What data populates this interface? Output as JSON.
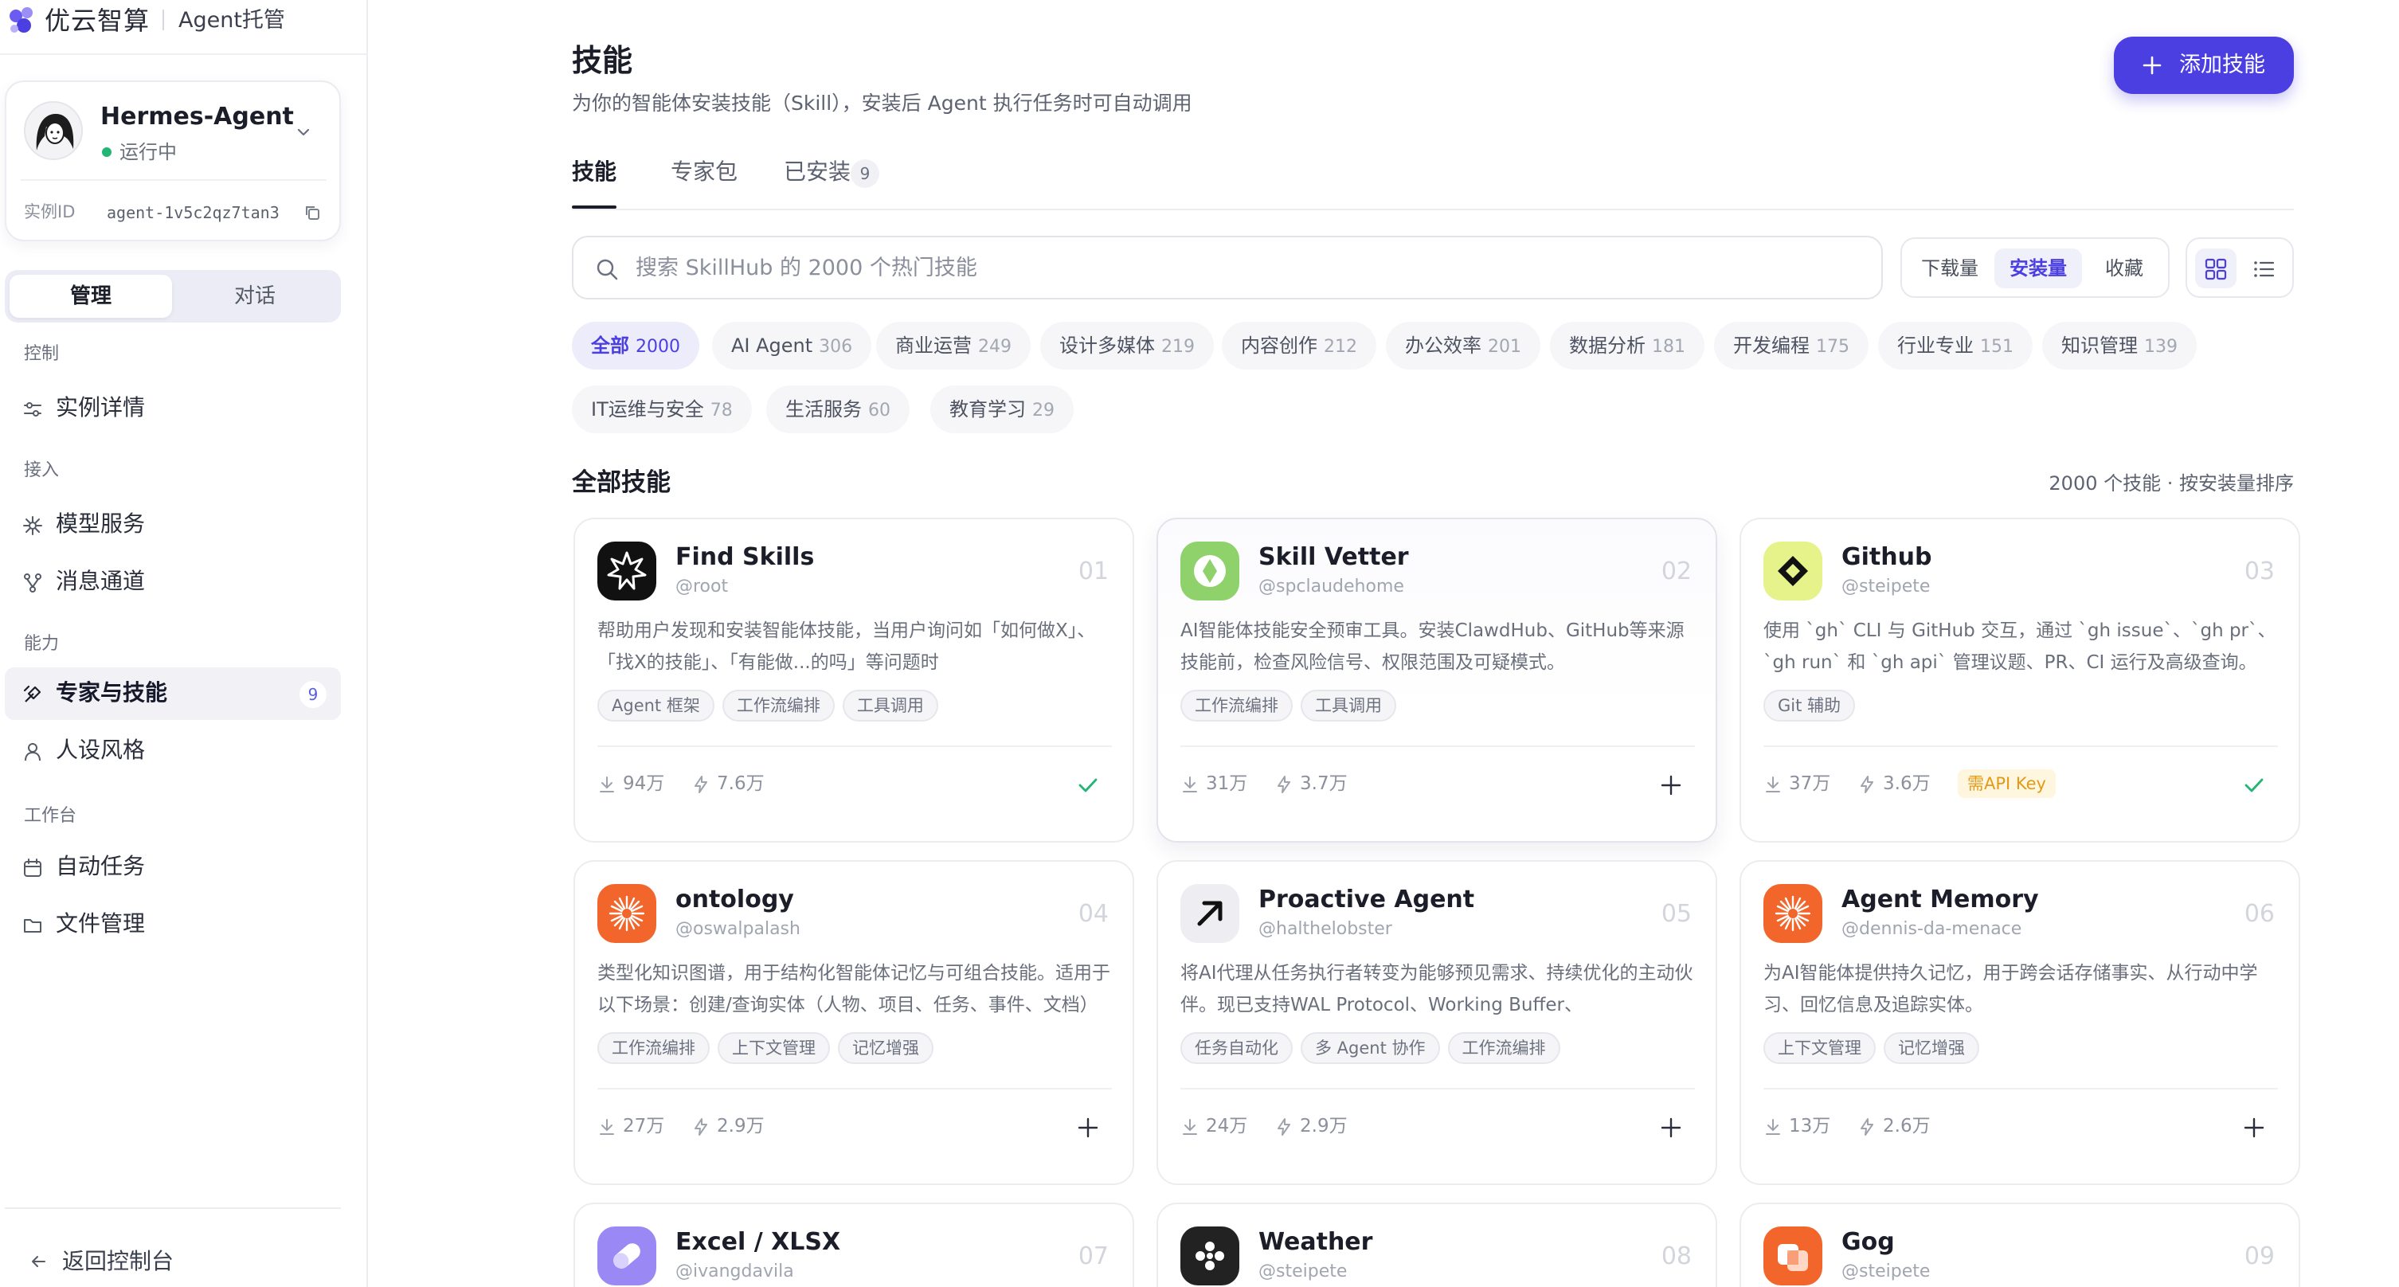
{
  "brand": {
    "name": "优云智算",
    "product": "Agent托管"
  },
  "agent": {
    "name": "Hermes-Agent",
    "status": "运行中",
    "instance_label": "实例ID",
    "instance_id": "agent-1v5c2qz7tan3"
  },
  "mode_tabs": {
    "manage": "管理",
    "chat": "对话"
  },
  "nav": {
    "sections": [
      {
        "label": "控制",
        "items": [
          {
            "label": "实例详情",
            "icon": "sliders-icon"
          }
        ]
      },
      {
        "label": "接入",
        "items": [
          {
            "label": "模型服务",
            "icon": "spark-icon"
          },
          {
            "label": "消息通道",
            "icon": "branch-icon"
          }
        ]
      },
      {
        "label": "能力",
        "items": [
          {
            "label": "专家与技能",
            "icon": "tool-icon",
            "badge": "9",
            "active": true
          },
          {
            "label": "人设风格",
            "icon": "user-icon"
          }
        ]
      },
      {
        "label": "工作台",
        "items": [
          {
            "label": "自动任务",
            "icon": "calendar-icon"
          },
          {
            "label": "文件管理",
            "icon": "folder-icon"
          }
        ]
      }
    ],
    "back": "返回控制台"
  },
  "page": {
    "title": "技能",
    "subtitle": "为你的智能体安装技能（Skill），安装后 Agent 执行任务时可自动调用",
    "add_button": "添加技能",
    "tabs": [
      {
        "label": "技能",
        "active": true
      },
      {
        "label": "专家包"
      },
      {
        "label": "已安装",
        "badge": "9"
      }
    ],
    "search_placeholder": "搜索 SkillHub 的 2000 个热门技能",
    "sort": [
      {
        "label": "下载量"
      },
      {
        "label": "安装量",
        "active": true
      },
      {
        "label": "收藏"
      }
    ],
    "view_mode": "grid"
  },
  "categories": [
    {
      "label": "全部",
      "count": "2000",
      "active": true
    },
    {
      "label": "AI Agent",
      "count": "306"
    },
    {
      "label": "商业运营",
      "count": "249"
    },
    {
      "label": "设计多媒体",
      "count": "219"
    },
    {
      "label": "内容创作",
      "count": "212"
    },
    {
      "label": "办公效率",
      "count": "201"
    },
    {
      "label": "数据分析",
      "count": "181"
    },
    {
      "label": "开发编程",
      "count": "175"
    },
    {
      "label": "行业专业",
      "count": "151"
    },
    {
      "label": "知识管理",
      "count": "139"
    },
    {
      "label": "IT运维与安全",
      "count": "78"
    },
    {
      "label": "生活服务",
      "count": "60"
    },
    {
      "label": "教育学习",
      "count": "29"
    }
  ],
  "list": {
    "title": "全部技能",
    "meta": "2000 个技能 · 按安装量排序"
  },
  "skills": [
    {
      "num": "01",
      "name": "Find Skills",
      "author": "@root",
      "desc": "帮助用户发现和安装智能体技能，当用户询问如「如何做X」、「找X的技能」、「有能做...的吗」等问题时",
      "tags": [
        "Agent 框架",
        "工作流编排",
        "工具调用"
      ],
      "downloads": "94万",
      "installs": "7.6万",
      "installed": true,
      "icon_color": "#111111"
    },
    {
      "num": "02",
      "name": "Skill Vetter",
      "author": "@spclaudehome",
      "desc": "AI智能体技能安全预审工具。安装ClawdHub、GitHub等来源技能前，检查风险信号、权限范围及可疑模式。",
      "tags": [
        "工作流编排",
        "工具调用"
      ],
      "downloads": "31万",
      "installs": "3.7万",
      "installed": false,
      "icon_color": "#8fd16a"
    },
    {
      "num": "03",
      "name": "Github",
      "author": "@steipete",
      "desc": "使用 `gh` CLI 与 GitHub 交互，通过 `gh issue`、`gh pr`、`gh run` 和 `gh api` 管理议题、PR、CI 运行及高级查询。",
      "tags": [
        "Git 辅助"
      ],
      "downloads": "37万",
      "installs": "3.6万",
      "installed": true,
      "api_key": "需API Key",
      "icon_color": "#e6f28a"
    },
    {
      "num": "04",
      "name": "ontology",
      "author": "@oswalpalash",
      "desc": "类型化知识图谱，用于结构化智能体记忆与可组合技能。适用于以下场景：创建/查询实体（人物、项目、任务、事件、文档）",
      "tags": [
        "工作流编排",
        "上下文管理",
        "记忆增强"
      ],
      "downloads": "27万",
      "installs": "2.9万",
      "installed": false,
      "icon_color": "#f2662b"
    },
    {
      "num": "05",
      "name": "Proactive Agent",
      "author": "@halthelobster",
      "desc": "将AI代理从任务执行者转变为能够预见需求、持续优化的主动伙伴。现已支持WAL Protocol、Working Buffer、Autonomous Crons",
      "tags": [
        "任务自动化",
        "多 Agent 协作",
        "工作流编排"
      ],
      "downloads": "24万",
      "installs": "2.9万",
      "installed": false,
      "icon_color": "#eeeef2"
    },
    {
      "num": "06",
      "name": "Agent Memory",
      "author": "@dennis-da-menace",
      "desc": "为AI智能体提供持久记忆，用于跨会话存储事实、从行动中学习、回忆信息及追踪实体。",
      "tags": [
        "上下文管理",
        "记忆增强"
      ],
      "downloads": "13万",
      "installs": "2.6万",
      "installed": false,
      "icon_color": "#f2662b"
    },
    {
      "num": "07",
      "name": "Excel / XLSX",
      "author": "@ivangdavila",
      "desc": "",
      "tags": [],
      "downloads": "",
      "installs": "",
      "installed": false,
      "icon_color": "#9a88f5"
    },
    {
      "num": "08",
      "name": "Weather",
      "author": "@steipete",
      "desc": "",
      "tags": [],
      "downloads": "",
      "installs": "",
      "installed": false,
      "icon_color": "#222222"
    },
    {
      "num": "09",
      "name": "Gog",
      "author": "@steipete",
      "desc": "",
      "tags": [],
      "downloads": "",
      "installs": "",
      "installed": false,
      "icon_color": "#f2662b"
    }
  ],
  "colors": {
    "accent": "#4b3fe1",
    "success": "#22b573",
    "warning": "#e39a16"
  }
}
